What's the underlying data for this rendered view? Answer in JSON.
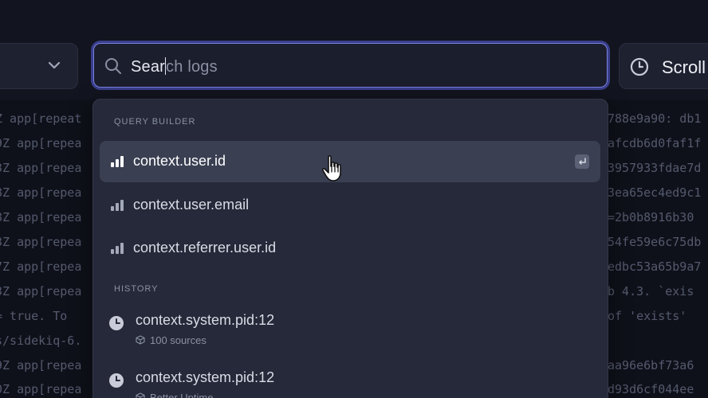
{
  "search": {
    "typed": "Sear",
    "rest": "ch logs"
  },
  "scroll_button": {
    "label": "Scroll"
  },
  "panel": {
    "query_builder_label": "QUERY BUILDER",
    "history_label": "HISTORY",
    "query_items": [
      {
        "label": "context.user.id",
        "active": true
      },
      {
        "label": "context.user.email",
        "active": false
      },
      {
        "label": "context.referrer.user.id",
        "active": false
      }
    ],
    "history_items": [
      {
        "label": "context.system.pid:12",
        "sub": "100 sources"
      },
      {
        "label": "context.system.pid:12",
        "sub": "Better Uptime"
      }
    ]
  },
  "logs": {
    "left": [
      "Z app[repeat",
      "9Z app[repea",
      "3Z app[repea",
      "8Z app[repea",
      "8Z app[repea",
      "3Z app[repea",
      "7Z app[repea",
      "3Z app[repea",
      " =  true. To",
      "s/sidekiq-6.",
      "9Z app[repea",
      "0Z app[repea"
    ],
    "right": [
      "788e9a90: db1",
      "afcdb6d0faf1f",
      "3957933fdae7d",
      "3ea65ec4ed9c1",
      "=2b0b8916b30",
      "54fe59e6c75db",
      "edbc53a65b9a7",
      "b 4.3. `exis",
      "of 'exists'",
      "",
      "aa96e6bf73a6",
      "d93d6cf044ee"
    ]
  },
  "colors": {
    "accent": "#7a80e0",
    "panel": "#252939",
    "active_row": "#3a3f52"
  }
}
